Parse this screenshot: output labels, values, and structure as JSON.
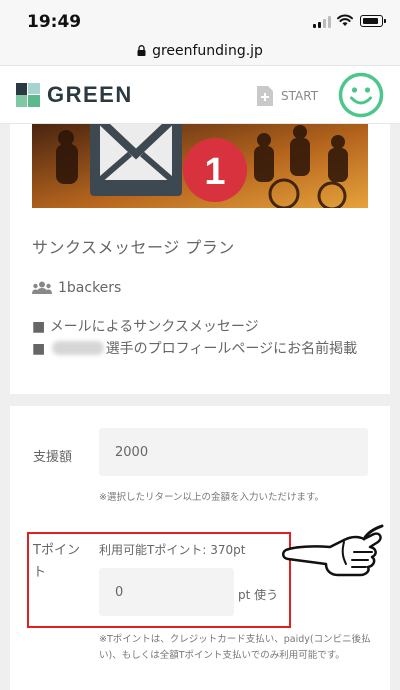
{
  "status_bar": {
    "time": "19:49"
  },
  "url_bar": {
    "domain": "greenfunding.jp"
  },
  "header": {
    "logo_text": "GREEN",
    "start_label": "START",
    "brand_colors": {
      "dark": "#2b3a42",
      "green": "#5bb98b",
      "teal": "#a8d4d0"
    },
    "avatar_color": "#4cc68a"
  },
  "plan": {
    "banner_badge": "1",
    "title": "サンクスメッセージ プラン",
    "backers": "1backers",
    "rewards": [
      {
        "prefix": "■ ",
        "text": "メールによるサンクスメッセージ"
      },
      {
        "prefix": "■ ",
        "text": "選手のプロフィールページにお名前掲載"
      }
    ]
  },
  "form": {
    "support_label": "支援額",
    "amount_value": "2000",
    "amount_note": "※選択したリターン以上の金額を入力いただけます。",
    "point_label": "Tポイント",
    "point_available": "利用可能Tポイント: 370pt",
    "point_value": "0",
    "point_unit": "pt 使う",
    "point_note": "※Tポイントは、クレジットカード支払い、paidy(コンビニ後払い)、もしくは全額Tポイント支払いでのみ利用可能です。"
  },
  "annotation": {
    "highlight_color": "#e02020"
  }
}
